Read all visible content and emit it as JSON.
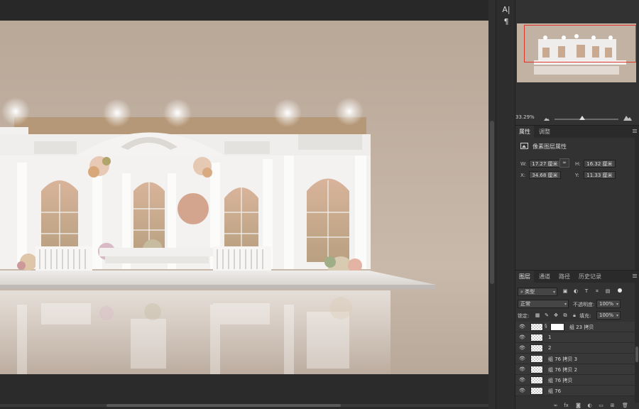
{
  "tools": {
    "character_icon": "A|",
    "paragraph_icon": "¶"
  },
  "navigator": {
    "zoom": "33.29%"
  },
  "properties": {
    "tabs": [
      "属性",
      "调整"
    ],
    "title": "像素图层属性",
    "w_label": "W:",
    "w_value": "17.27 厘米",
    "h_label": "H:",
    "h_value": "16.32 厘米",
    "x_label": "X:",
    "x_value": "34.68 厘米",
    "y_label": "Y:",
    "y_value": "11.33 厘米",
    "link_icon": "chain-link-icon"
  },
  "layers": {
    "tabs": [
      "图层",
      "通道",
      "路径",
      "历史记录"
    ],
    "filter_kind": "类型",
    "blend_mode": "正常",
    "opacity_label": "不透明度:",
    "opacity_value": "100%",
    "lock_label": "锁定:",
    "fill_label": "填充:",
    "fill_value": "100%",
    "items": [
      {
        "name": "组 23 拷贝",
        "has_mask": true
      },
      {
        "name": "1",
        "has_mask": false
      },
      {
        "name": "2",
        "has_mask": false
      },
      {
        "name": "组 76 拷贝 3",
        "has_mask": false
      },
      {
        "name": "组 76 拷贝 2",
        "has_mask": false
      },
      {
        "name": "组 76 拷贝",
        "has_mask": false
      },
      {
        "name": "组 76",
        "has_mask": false
      }
    ]
  },
  "colors": {
    "canvas_bg": "#c3b3a4",
    "panel_bg": "#323232",
    "nav_frame": "#e0332a",
    "backdrop": "#ffffff"
  }
}
